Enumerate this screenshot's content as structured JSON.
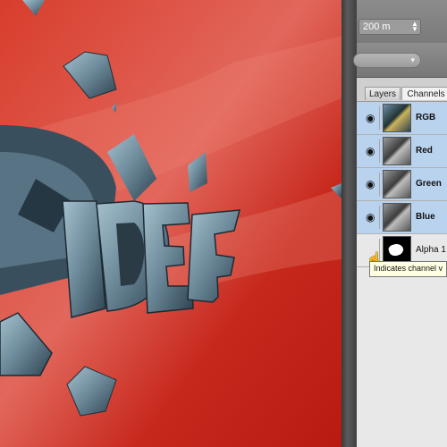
{
  "toolbar": {
    "zoom_value": "200 m",
    "stepper_icon": "up-down-arrows-icon",
    "dropdown_icon": "chevron-down-icon"
  },
  "canvas": {
    "artwork_text": "IDE",
    "background_color": "#c8281c"
  },
  "panel": {
    "tabs": [
      {
        "label": "Layers",
        "active": false
      },
      {
        "label": "Channels",
        "active": true
      }
    ],
    "channels": [
      {
        "name": "RGB",
        "selected": true,
        "visible": true
      },
      {
        "name": "Red",
        "selected": true,
        "visible": true
      },
      {
        "name": "Green",
        "selected": true,
        "visible": true
      },
      {
        "name": "Blue",
        "selected": true,
        "visible": true
      },
      {
        "name": "Alpha 1",
        "selected": false,
        "visible": false
      }
    ],
    "tooltip": "Indicates channel v",
    "cursor_icon": "hand-pointer-icon"
  }
}
